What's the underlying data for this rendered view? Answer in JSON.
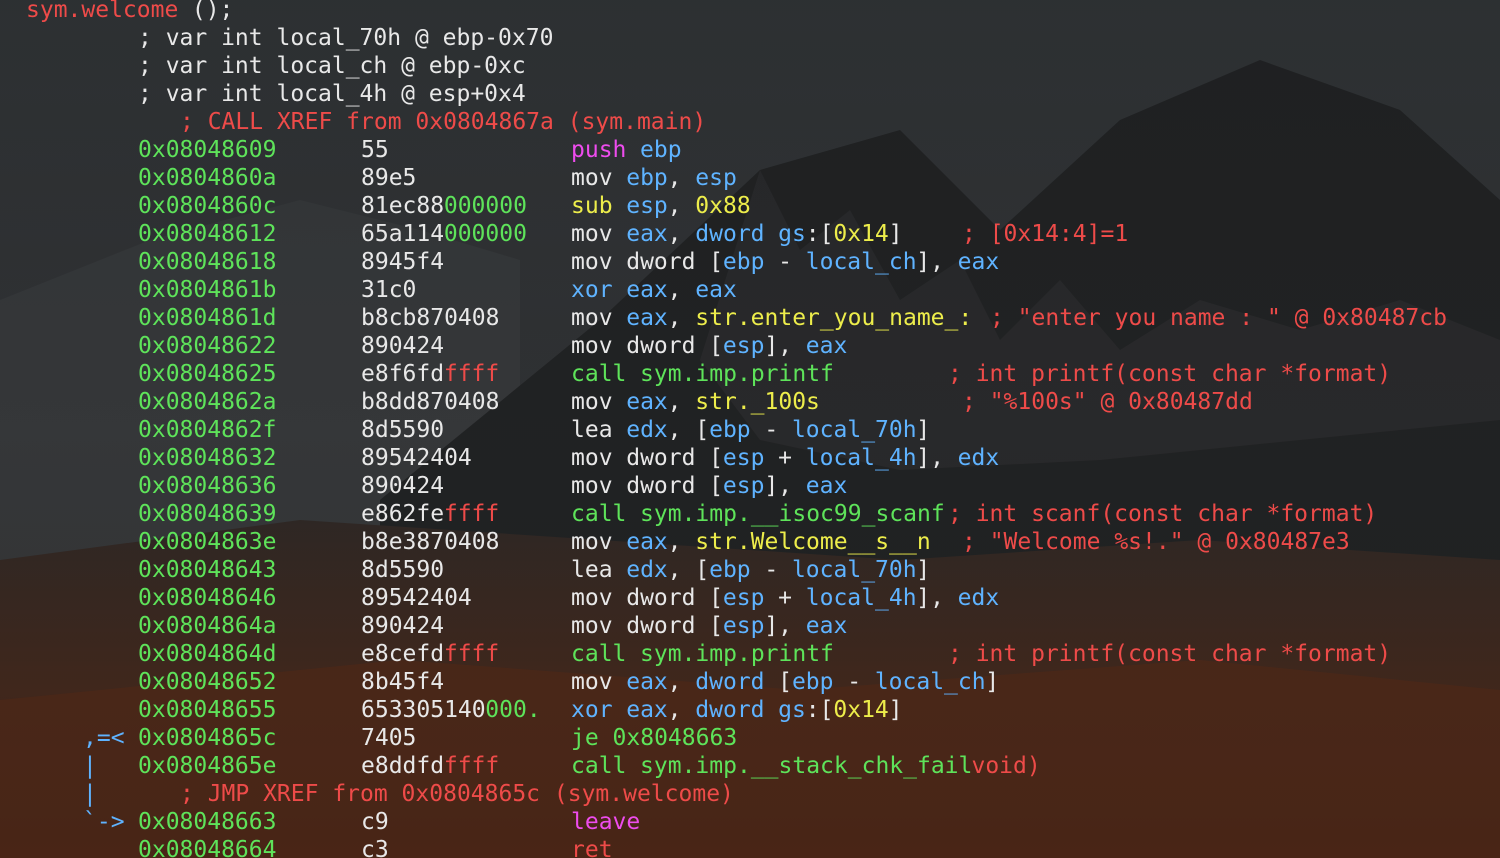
{
  "colors": {
    "address": "#5ee35a",
    "comment": "#ee4b49",
    "register": "#5fb3ff",
    "text": "#e8e8e8",
    "string_ref": "#eded4b",
    "special_op": "#ee4cee"
  },
  "header": {
    "function_name": "sym.welcome",
    "function_suffix": " ();"
  },
  "vars": [
    "; var int local_70h @ ebp-0x70",
    "; var int local_ch @ ebp-0xc",
    "; var int local_4h @ esp+0x4"
  ],
  "xref_call": "; CALL XREF from 0x0804867a (sym.main)",
  "xref_jmp": "; JMP XREF from 0x0804865c (sym.welcome)",
  "rows": [
    {
      "addr": "0x08048609",
      "b1": "55",
      "b2": "",
      "op": [
        [
          "push",
          "magenta"
        ],
        [
          " ",
          ""
        ],
        [
          "ebp",
          "blue"
        ]
      ],
      "cm": ""
    },
    {
      "addr": "0x0804860a",
      "b1": "89e5",
      "b2": "",
      "op": [
        [
          "mov ",
          "white"
        ],
        [
          "ebp",
          "blue"
        ],
        [
          ", ",
          "white"
        ],
        [
          "esp",
          "blue"
        ]
      ],
      "cm": ""
    },
    {
      "addr": "0x0804860c",
      "b1": "81ec88",
      "b2": "000000",
      "op": [
        [
          "sub ",
          "yellow"
        ],
        [
          "esp",
          "blue"
        ],
        [
          ", ",
          "white"
        ],
        [
          "0x88",
          "yellow"
        ]
      ],
      "cm": ""
    },
    {
      "addr": "0x08048612",
      "b1": "65a114",
      "b2": "000000",
      "op": [
        [
          "mov ",
          "white"
        ],
        [
          "eax",
          "blue"
        ],
        [
          ", ",
          "white"
        ],
        [
          "dword ",
          "blue"
        ],
        [
          "gs",
          "blue"
        ],
        [
          ":[",
          "white"
        ],
        [
          "0x14",
          "yellow"
        ],
        [
          "]",
          "white"
        ]
      ],
      "cm": "; [0x14:4]=1",
      "cmx": 962
    },
    {
      "addr": "0x08048618",
      "b1": "8945f4",
      "b2": "",
      "op": [
        [
          "mov ",
          "white"
        ],
        [
          "dword ",
          "white"
        ],
        [
          "[",
          "white"
        ],
        [
          "ebp",
          "blue"
        ],
        [
          " - ",
          "white"
        ],
        [
          "local_ch",
          "blue"
        ],
        [
          "], ",
          "white"
        ],
        [
          "eax",
          "blue"
        ]
      ],
      "cm": ""
    },
    {
      "addr": "0x0804861b",
      "b1": "31c0",
      "b2": "",
      "op": [
        [
          "xor ",
          "blue"
        ],
        [
          "eax",
          "blue"
        ],
        [
          ", ",
          "white"
        ],
        [
          "eax",
          "blue"
        ]
      ],
      "cm": ""
    },
    {
      "addr": "0x0804861d",
      "b1": "b8cb870408",
      "b2": "",
      "op": [
        [
          "mov ",
          "white"
        ],
        [
          "eax",
          "blue"
        ],
        [
          ", ",
          "white"
        ],
        [
          "str.enter_you_name_:",
          "yellow"
        ]
      ],
      "cm": "; \"enter you name : \" @ 0x80487cb",
      "cmx": 990
    },
    {
      "addr": "0x08048622",
      "b1": "890424",
      "b2": "",
      "op": [
        [
          "mov ",
          "white"
        ],
        [
          "dword ",
          "white"
        ],
        [
          "[",
          "white"
        ],
        [
          "esp",
          "blue"
        ],
        [
          "], ",
          "white"
        ],
        [
          "eax",
          "blue"
        ]
      ],
      "cm": ""
    },
    {
      "addr": "0x08048625",
      "b1": "e8f6fd",
      "b2": "ffff",
      "op": [
        [
          "call ",
          "green"
        ],
        [
          "sym.imp.printf",
          "green"
        ]
      ],
      "cm": "; int printf(const char *format)",
      "cmx": 948
    },
    {
      "addr": "0x0804862a",
      "b1": "b8dd870408",
      "b2": "",
      "op": [
        [
          "mov ",
          "white"
        ],
        [
          "eax",
          "blue"
        ],
        [
          ", ",
          "white"
        ],
        [
          "str._100s",
          "yellow"
        ]
      ],
      "cm": "; \"%100s\" @ 0x80487dd",
      "cmx": 962
    },
    {
      "addr": "0x0804862f",
      "b1": "8d5590",
      "b2": "",
      "op": [
        [
          "lea ",
          "white"
        ],
        [
          "edx",
          "blue"
        ],
        [
          ", ",
          "white"
        ],
        [
          "[",
          "white"
        ],
        [
          "ebp",
          "blue"
        ],
        [
          " - ",
          "white"
        ],
        [
          "local_70h",
          "blue"
        ],
        [
          "]",
          "white"
        ]
      ],
      "cm": ""
    },
    {
      "addr": "0x08048632",
      "b1": "89542404",
      "b2": "",
      "op": [
        [
          "mov ",
          "white"
        ],
        [
          "dword ",
          "white"
        ],
        [
          "[",
          "white"
        ],
        [
          "esp",
          "blue"
        ],
        [
          " + ",
          "white"
        ],
        [
          "local_4h",
          "blue"
        ],
        [
          "], ",
          "white"
        ],
        [
          "edx",
          "blue"
        ]
      ],
      "cm": ""
    },
    {
      "addr": "0x08048636",
      "b1": "890424",
      "b2": "",
      "op": [
        [
          "mov ",
          "white"
        ],
        [
          "dword ",
          "white"
        ],
        [
          "[",
          "white"
        ],
        [
          "esp",
          "blue"
        ],
        [
          "], ",
          "white"
        ],
        [
          "eax",
          "blue"
        ]
      ],
      "cm": ""
    },
    {
      "addr": "0x08048639",
      "b1": "e862fe",
      "b2": "ffff",
      "op": [
        [
          "call ",
          "green"
        ],
        [
          "sym.imp.__isoc99_scanf",
          "green"
        ]
      ],
      "cm": "; int scanf(const char *format)",
      "cmx": 948
    },
    {
      "addr": "0x0804863e",
      "b1": "b8e3870408",
      "b2": "",
      "op": [
        [
          "mov ",
          "white"
        ],
        [
          "eax",
          "blue"
        ],
        [
          ", ",
          "white"
        ],
        [
          "str.Welcome__s__n",
          "yellow"
        ]
      ],
      "cm": "; \"Welcome %s!.\" @ 0x80487e3",
      "cmx": 962
    },
    {
      "addr": "0x08048643",
      "b1": "8d5590",
      "b2": "",
      "op": [
        [
          "lea ",
          "white"
        ],
        [
          "edx",
          "blue"
        ],
        [
          ", ",
          "white"
        ],
        [
          "[",
          "white"
        ],
        [
          "ebp",
          "blue"
        ],
        [
          " - ",
          "white"
        ],
        [
          "local_70h",
          "blue"
        ],
        [
          "]",
          "white"
        ]
      ],
      "cm": ""
    },
    {
      "addr": "0x08048646",
      "b1": "89542404",
      "b2": "",
      "op": [
        [
          "mov ",
          "white"
        ],
        [
          "dword ",
          "white"
        ],
        [
          "[",
          "white"
        ],
        [
          "esp",
          "blue"
        ],
        [
          " + ",
          "white"
        ],
        [
          "local_4h",
          "blue"
        ],
        [
          "], ",
          "white"
        ],
        [
          "edx",
          "blue"
        ]
      ],
      "cm": ""
    },
    {
      "addr": "0x0804864a",
      "b1": "890424",
      "b2": "",
      "op": [
        [
          "mov ",
          "white"
        ],
        [
          "dword ",
          "white"
        ],
        [
          "[",
          "white"
        ],
        [
          "esp",
          "blue"
        ],
        [
          "], ",
          "white"
        ],
        [
          "eax",
          "blue"
        ]
      ],
      "cm": ""
    },
    {
      "addr": "0x0804864d",
      "b1": "e8cefd",
      "b2": "ffff",
      "op": [
        [
          "call ",
          "green"
        ],
        [
          "sym.imp.printf",
          "green"
        ]
      ],
      "cm": "; int printf(const char *format)",
      "cmx": 948
    },
    {
      "addr": "0x08048652",
      "b1": "8b45f4",
      "b2": "",
      "op": [
        [
          "mov ",
          "white"
        ],
        [
          "eax",
          "blue"
        ],
        [
          ", ",
          "white"
        ],
        [
          "dword ",
          "blue"
        ],
        [
          "[",
          "white"
        ],
        [
          "ebp",
          "blue"
        ],
        [
          " - ",
          "white"
        ],
        [
          "local_ch",
          "blue"
        ],
        [
          "]",
          "white"
        ]
      ],
      "cm": ""
    },
    {
      "addr": "0x08048655",
      "b1": "653305140",
      "b2": "000.",
      "op": [
        [
          "xor ",
          "blue"
        ],
        [
          "eax",
          "blue"
        ],
        [
          ", ",
          "white"
        ],
        [
          "dword ",
          "blue"
        ],
        [
          "gs",
          "blue"
        ],
        [
          ":[",
          "white"
        ],
        [
          "0x14",
          "yellow"
        ],
        [
          "]",
          "white"
        ]
      ],
      "cm": ""
    },
    {
      "addr": "0x0804865c",
      "b1": "7405",
      "b2": "",
      "op": [
        [
          "je 0x8048663",
          "green"
        ]
      ],
      "cm": "",
      "gutter": ",=<"
    },
    {
      "addr": "0x0804865e",
      "b1": "e8ddfd",
      "b2": "ffff",
      "op": [
        [
          "call ",
          "green"
        ],
        [
          "sym.imp.__stack_chk_fail",
          "green"
        ],
        [
          "void)",
          "red"
        ]
      ],
      "cm": "",
      "gutter": "|"
    },
    {
      "xref": true,
      "gutter": "|"
    },
    {
      "addr": "0x08048663",
      "b1": "c9",
      "b2": "",
      "op": [
        [
          "leave",
          "magenta"
        ]
      ],
      "cm": "",
      "gutter": "`->"
    },
    {
      "addr": "0x08048664",
      "b1": "c3",
      "b2": "",
      "op": [
        [
          "ret",
          "red"
        ]
      ],
      "cm": ""
    }
  ]
}
